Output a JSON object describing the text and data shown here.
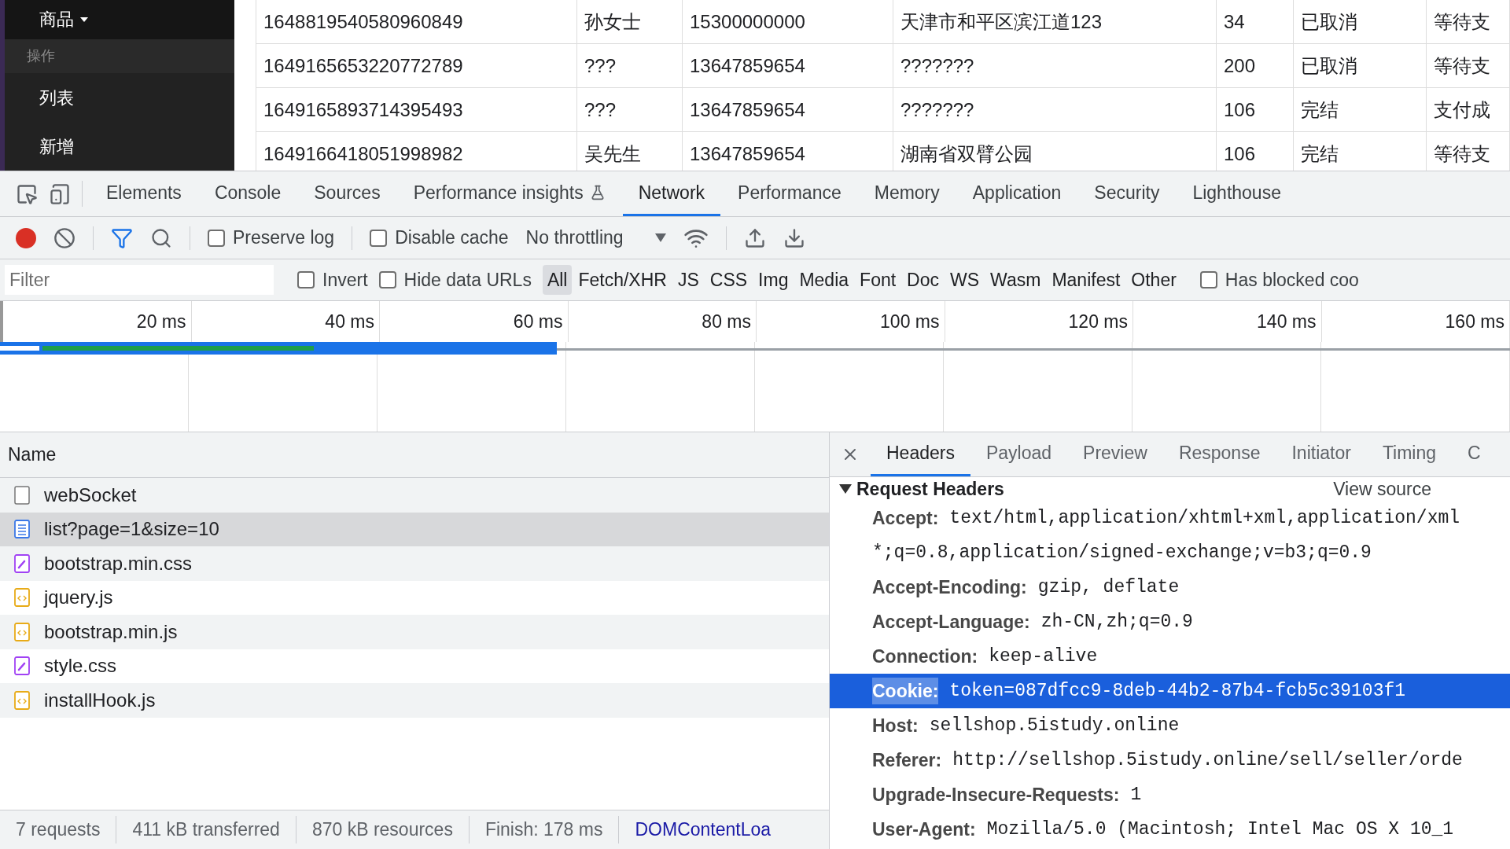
{
  "page": {
    "sidebar": {
      "items": [
        {
          "label": "商品",
          "kind": "dropdown"
        },
        {
          "label": "操作",
          "kind": "section"
        },
        {
          "label": "列表",
          "kind": "link"
        },
        {
          "label": "新增",
          "kind": "link"
        }
      ]
    },
    "table": {
      "rows": [
        [
          "1648819540580960849",
          "孙女士",
          "15300000000",
          "天津市和平区滨江道123",
          "34",
          "已取消",
          "等待支"
        ],
        [
          "1649165653220772789",
          "???",
          "13647859654",
          "???????",
          "200",
          "已取消",
          "等待支"
        ],
        [
          "1649165893714395493",
          "???",
          "13647859654",
          "???????",
          "106",
          "完结",
          "支付成"
        ],
        [
          "1649166418051998982",
          "吴先生",
          "13647859654",
          "湖南省双臂公园",
          "106",
          "完结",
          "等待支"
        ]
      ]
    }
  },
  "devtools": {
    "tabs": [
      {
        "label": "Elements",
        "selected": false
      },
      {
        "label": "Console",
        "selected": false
      },
      {
        "label": "Sources",
        "selected": false
      },
      {
        "label": "Performance insights",
        "selected": false,
        "experimental": true
      },
      {
        "label": "Network",
        "selected": true
      },
      {
        "label": "Performance",
        "selected": false
      },
      {
        "label": "Memory",
        "selected": false
      },
      {
        "label": "Application",
        "selected": false
      },
      {
        "label": "Security",
        "selected": false
      },
      {
        "label": "Lighthouse",
        "selected": false
      }
    ],
    "toolbar": {
      "recording": true,
      "preserve_log": {
        "label": "Preserve log",
        "checked": false
      },
      "disable_cache": {
        "label": "Disable cache",
        "checked": false
      },
      "throttling": "No throttling"
    },
    "filter_bar": {
      "placeholder": "Filter",
      "invert": {
        "label": "Invert",
        "checked": false
      },
      "hide_data_urls": {
        "label": "Hide data URLs",
        "checked": false
      },
      "types": [
        {
          "label": "All",
          "selected": true
        },
        {
          "label": "Fetch/XHR",
          "selected": false
        },
        {
          "label": "JS",
          "selected": false
        },
        {
          "label": "CSS",
          "selected": false
        },
        {
          "label": "Img",
          "selected": false
        },
        {
          "label": "Media",
          "selected": false
        },
        {
          "label": "Font",
          "selected": false
        },
        {
          "label": "Doc",
          "selected": false
        },
        {
          "label": "WS",
          "selected": false
        },
        {
          "label": "Wasm",
          "selected": false
        },
        {
          "label": "Manifest",
          "selected": false
        },
        {
          "label": "Other",
          "selected": false
        }
      ],
      "has_blocked": {
        "label": "Has blocked coo",
        "checked": false
      }
    },
    "timeline": {
      "ticks": [
        "20 ms",
        "40 ms",
        "60 ms",
        "80 ms",
        "100 ms",
        "120 ms",
        "140 ms",
        "160 ms"
      ]
    },
    "requests": {
      "column": "Name",
      "rows": [
        {
          "name": "webSocket",
          "kind": "websocket",
          "selected": false
        },
        {
          "name": "list?page=1&size=10",
          "kind": "document",
          "selected": true
        },
        {
          "name": "bootstrap.min.css",
          "kind": "stylesheet",
          "selected": false
        },
        {
          "name": "jquery.js",
          "kind": "script",
          "selected": false
        },
        {
          "name": "bootstrap.min.js",
          "kind": "script",
          "selected": false
        },
        {
          "name": "style.css",
          "kind": "stylesheet",
          "selected": false
        },
        {
          "name": "installHook.js",
          "kind": "script",
          "selected": false
        }
      ]
    },
    "details": {
      "tabs": [
        {
          "label": "Headers",
          "selected": true
        },
        {
          "label": "Payload",
          "selected": false
        },
        {
          "label": "Preview",
          "selected": false
        },
        {
          "label": "Response",
          "selected": false
        },
        {
          "label": "Initiator",
          "selected": false
        },
        {
          "label": "Timing",
          "selected": false
        },
        {
          "label": "C",
          "selected": false
        }
      ],
      "section": {
        "title": "Request Headers",
        "expanded": true,
        "view_source": "View source"
      },
      "headers": [
        {
          "name": "Accept:",
          "value": "text/html,application/xhtml+xml,application/xml",
          "continuation": "*;q=0.8,application/signed-exchange;v=b3;q=0.9",
          "selected": false
        },
        {
          "name": "Accept-Encoding:",
          "value": "gzip, deflate",
          "selected": false
        },
        {
          "name": "Accept-Language:",
          "value": "zh-CN,zh;q=0.9",
          "selected": false
        },
        {
          "name": "Connection:",
          "value": "keep-alive",
          "selected": false
        },
        {
          "name": "Cookie:",
          "value": "token=087dfcc9-8deb-44b2-87b4-fcb5c39103f1",
          "selected": true
        },
        {
          "name": "Host:",
          "value": "sellshop.5istudy.online",
          "selected": false
        },
        {
          "name": "Referer:",
          "value": "http://sellshop.5istudy.online/sell/seller/orde",
          "selected": false
        },
        {
          "name": "Upgrade-Insecure-Requests:",
          "value": "1",
          "selected": false
        },
        {
          "name": "User-Agent:",
          "value": "Mozilla/5.0 (Macintosh; Intel Mac OS X 10_1",
          "selected": false
        }
      ]
    },
    "status_bar": [
      {
        "text": "7 requests",
        "kind": "text"
      },
      {
        "text": "411 kB transferred",
        "kind": "text"
      },
      {
        "text": "870 kB resources",
        "kind": "text"
      },
      {
        "text": "Finish: 178 ms",
        "kind": "text"
      },
      {
        "text": "DOMContentLoa",
        "kind": "link"
      }
    ]
  }
}
